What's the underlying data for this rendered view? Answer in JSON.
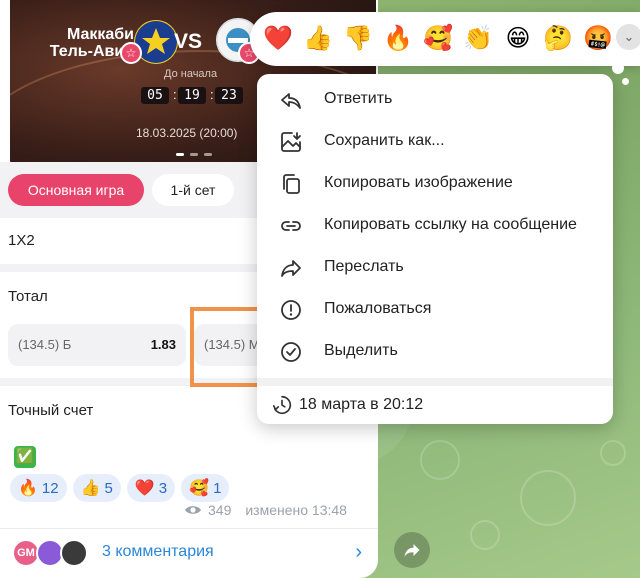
{
  "colors": {
    "accent_pink": "#e8436a",
    "link_blue": "#2a86d8",
    "highlight_orange": "#f0924a",
    "wallpaper_green": "#7faa6a"
  },
  "banner": {
    "team_home": "Маккаби Тель-Авив",
    "vs": "VS",
    "countdown_label": "До начала",
    "countdown": [
      "05",
      "19",
      "23"
    ],
    "date": "18.03.2025 (20:00)"
  },
  "bets": {
    "tabs": [
      {
        "label": "Основная игра",
        "active": true
      },
      {
        "label": "1-й сет",
        "active": false
      }
    ],
    "section_1x2": "1X2",
    "section_total": "Тотал",
    "total_odds": [
      {
        "label": "(134.5) Б",
        "value": "1.83"
      },
      {
        "label": "(134.5) М",
        "value": ""
      }
    ],
    "section_exact": "Точный счет"
  },
  "post": {
    "check_emoji": "✅",
    "reactions": [
      {
        "emoji": "🔥",
        "count": "12"
      },
      {
        "emoji": "👍",
        "count": "5"
      },
      {
        "emoji": "❤️",
        "count": "3"
      },
      {
        "emoji": "🥰",
        "count": "1"
      }
    ],
    "views": "349",
    "edited": "изменено 13:48",
    "comments_label": "3 комментария",
    "comment_avatars": [
      "GM"
    ]
  },
  "reaction_bar": {
    "emojis": [
      "❤️",
      "👍",
      "👎",
      "🔥",
      "🥰",
      "👏",
      "😁",
      "🤔",
      "🤬"
    ]
  },
  "context_menu": {
    "items": [
      {
        "label": "Ответить",
        "icon": "reply-icon"
      },
      {
        "label": "Сохранить как...",
        "icon": "save-image-icon"
      },
      {
        "label": "Копировать изображение",
        "icon": "copy-icon"
      },
      {
        "label": "Копировать ссылку на сообщение",
        "icon": "link-icon"
      },
      {
        "label": "Переслать",
        "icon": "forward-icon"
      },
      {
        "label": "Пожаловаться",
        "icon": "report-icon"
      },
      {
        "label": "Выделить",
        "icon": "select-check-icon"
      }
    ],
    "date": "18 марта в 20:12"
  }
}
